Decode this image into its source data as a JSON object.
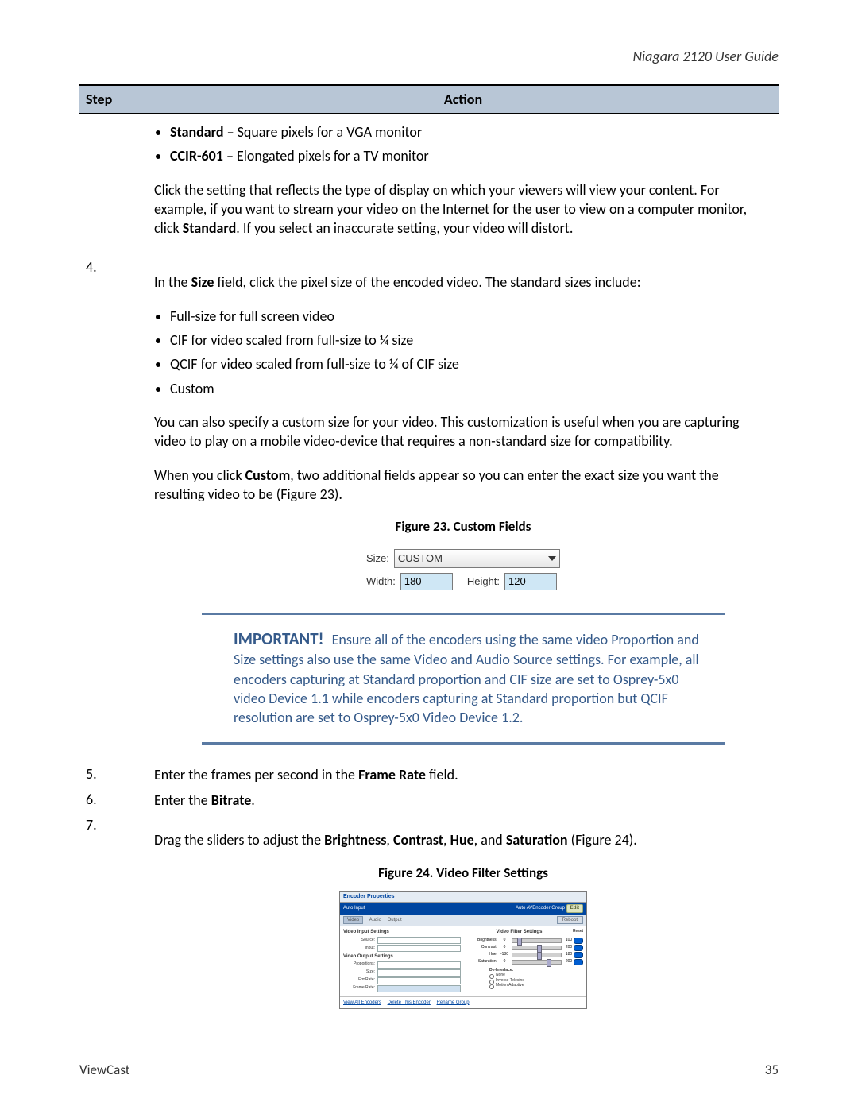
{
  "header": {
    "title": "Niagara 2120 User Guide"
  },
  "table": {
    "head": {
      "step": "Step",
      "action": "Action"
    }
  },
  "step3": {
    "bullet1_strong": "Standard",
    "bullet1_rest": " – Square pixels for a VGA monitor",
    "bullet2_strong": "CCIR-601",
    "bullet2_rest": " – Elongated pixels for a TV monitor",
    "para1a": "Click the setting that reflects the type of display on which your viewers will view your content. For example, if you want to stream your video on the Internet for the user to view on a computer monitor, click ",
    "para1b": "Standard",
    "para1c": ". If you select an inaccurate setting, your video will distort."
  },
  "step4": {
    "num": "4.",
    "intro_a": "In the ",
    "intro_b": "Size",
    "intro_c": " field, click the pixel size of the encoded video. The standard sizes include:",
    "b1": "Full-size for full screen video",
    "b2": "CIF for video scaled from full-size to ¼ size",
    "b3": "QCIF for video scaled from full-size to ¼ of CIF size",
    "b4": "Custom",
    "p1": "You can also specify a custom size for your video. This customization is useful when you are capturing video to play on a mobile video-device that requires a non-standard size for compatibility.",
    "p2a": "When you click ",
    "p2b": "Custom",
    "p2c": ", two additional fields appear so you can enter the exact size you want the resulting video to be (Figure 23).",
    "fig23_caption": "Figure 23. Custom Fields",
    "cf": {
      "size_label": "Size:",
      "size_value": "CUSTOM",
      "width_label": "Width:",
      "width_value": "180",
      "height_label": "Height:",
      "height_value": "120"
    },
    "importantLabel": "IMPORTANT!",
    "importantText": " Ensure all of the encoders using the same video Proportion and Size settings also use the same Video and Audio Source settings. For example, all encoders capturing at Standard proportion and CIF size are set to Osprey-5x0 video Device 1.1 while encoders capturing at Standard proportion but QCIF resolution are set to Osprey-5x0 Video Device 1.2."
  },
  "step5": {
    "num": "5.",
    "text_a": "Enter the frames per second in the ",
    "text_b": "Frame Rate",
    "text_c": " field."
  },
  "step6": {
    "num": "6.",
    "text_a": "Enter the ",
    "text_b": "Bitrate",
    "text_c": "."
  },
  "step7": {
    "num": "7.",
    "text_a": "Drag the sliders to adjust the ",
    "b1": "Brightness",
    "c1": ", ",
    "b2": "Contrast",
    "c2": ", ",
    "b3": "Hue",
    "c3": ", and ",
    "b4": "Saturation",
    "c4": " (Figure 24).",
    "fig24_caption": "Figure 24. Video Filter Settings"
  },
  "enc": {
    "title": "Encoder Properties",
    "auto_input_label": "Auto Input",
    "status_right": "Auto AVEncoder Group",
    "edit": "Edit",
    "tool_video": "Video",
    "tool_audio": "Audio",
    "tool_output": "Output",
    "reboot": "Reboot",
    "left_sect1": "Video Input Settings",
    "left_source_lbl": "Source:",
    "left_input_lbl": "Input:",
    "left_sect2": "Video Output Settings",
    "left_prop_lbl": "Proportions:",
    "left_size_lbl": "Size:",
    "left_fr_lbl": "FrmRate:",
    "left_frate_lbl": "Frame Rate:",
    "right_sect": "Video Filter Settings",
    "reset_lbl": "Reset",
    "s_bright": "Brightness:",
    "s_bright_min": "0",
    "s_bright_max": "100",
    "s_contrast": "Contrast:",
    "s_contrast_min": "0",
    "s_contrast_max": "200",
    "s_hue": "Hue:",
    "s_hue_min": "-180",
    "s_hue_max": "180",
    "s_sat": "Saturation:",
    "s_sat_min": "0",
    "s_sat_max": "200",
    "deint_title": "De-Interlace:",
    "di_none": "None",
    "di_inv": "Inverse Telecine",
    "di_mo": "Motion Adaptive",
    "footer_viewall": "View All Encoders",
    "footer_delete": "Delete This Encoder",
    "footer_rename": "Rename Group"
  },
  "footer": {
    "left": "ViewCast",
    "right": "35"
  }
}
